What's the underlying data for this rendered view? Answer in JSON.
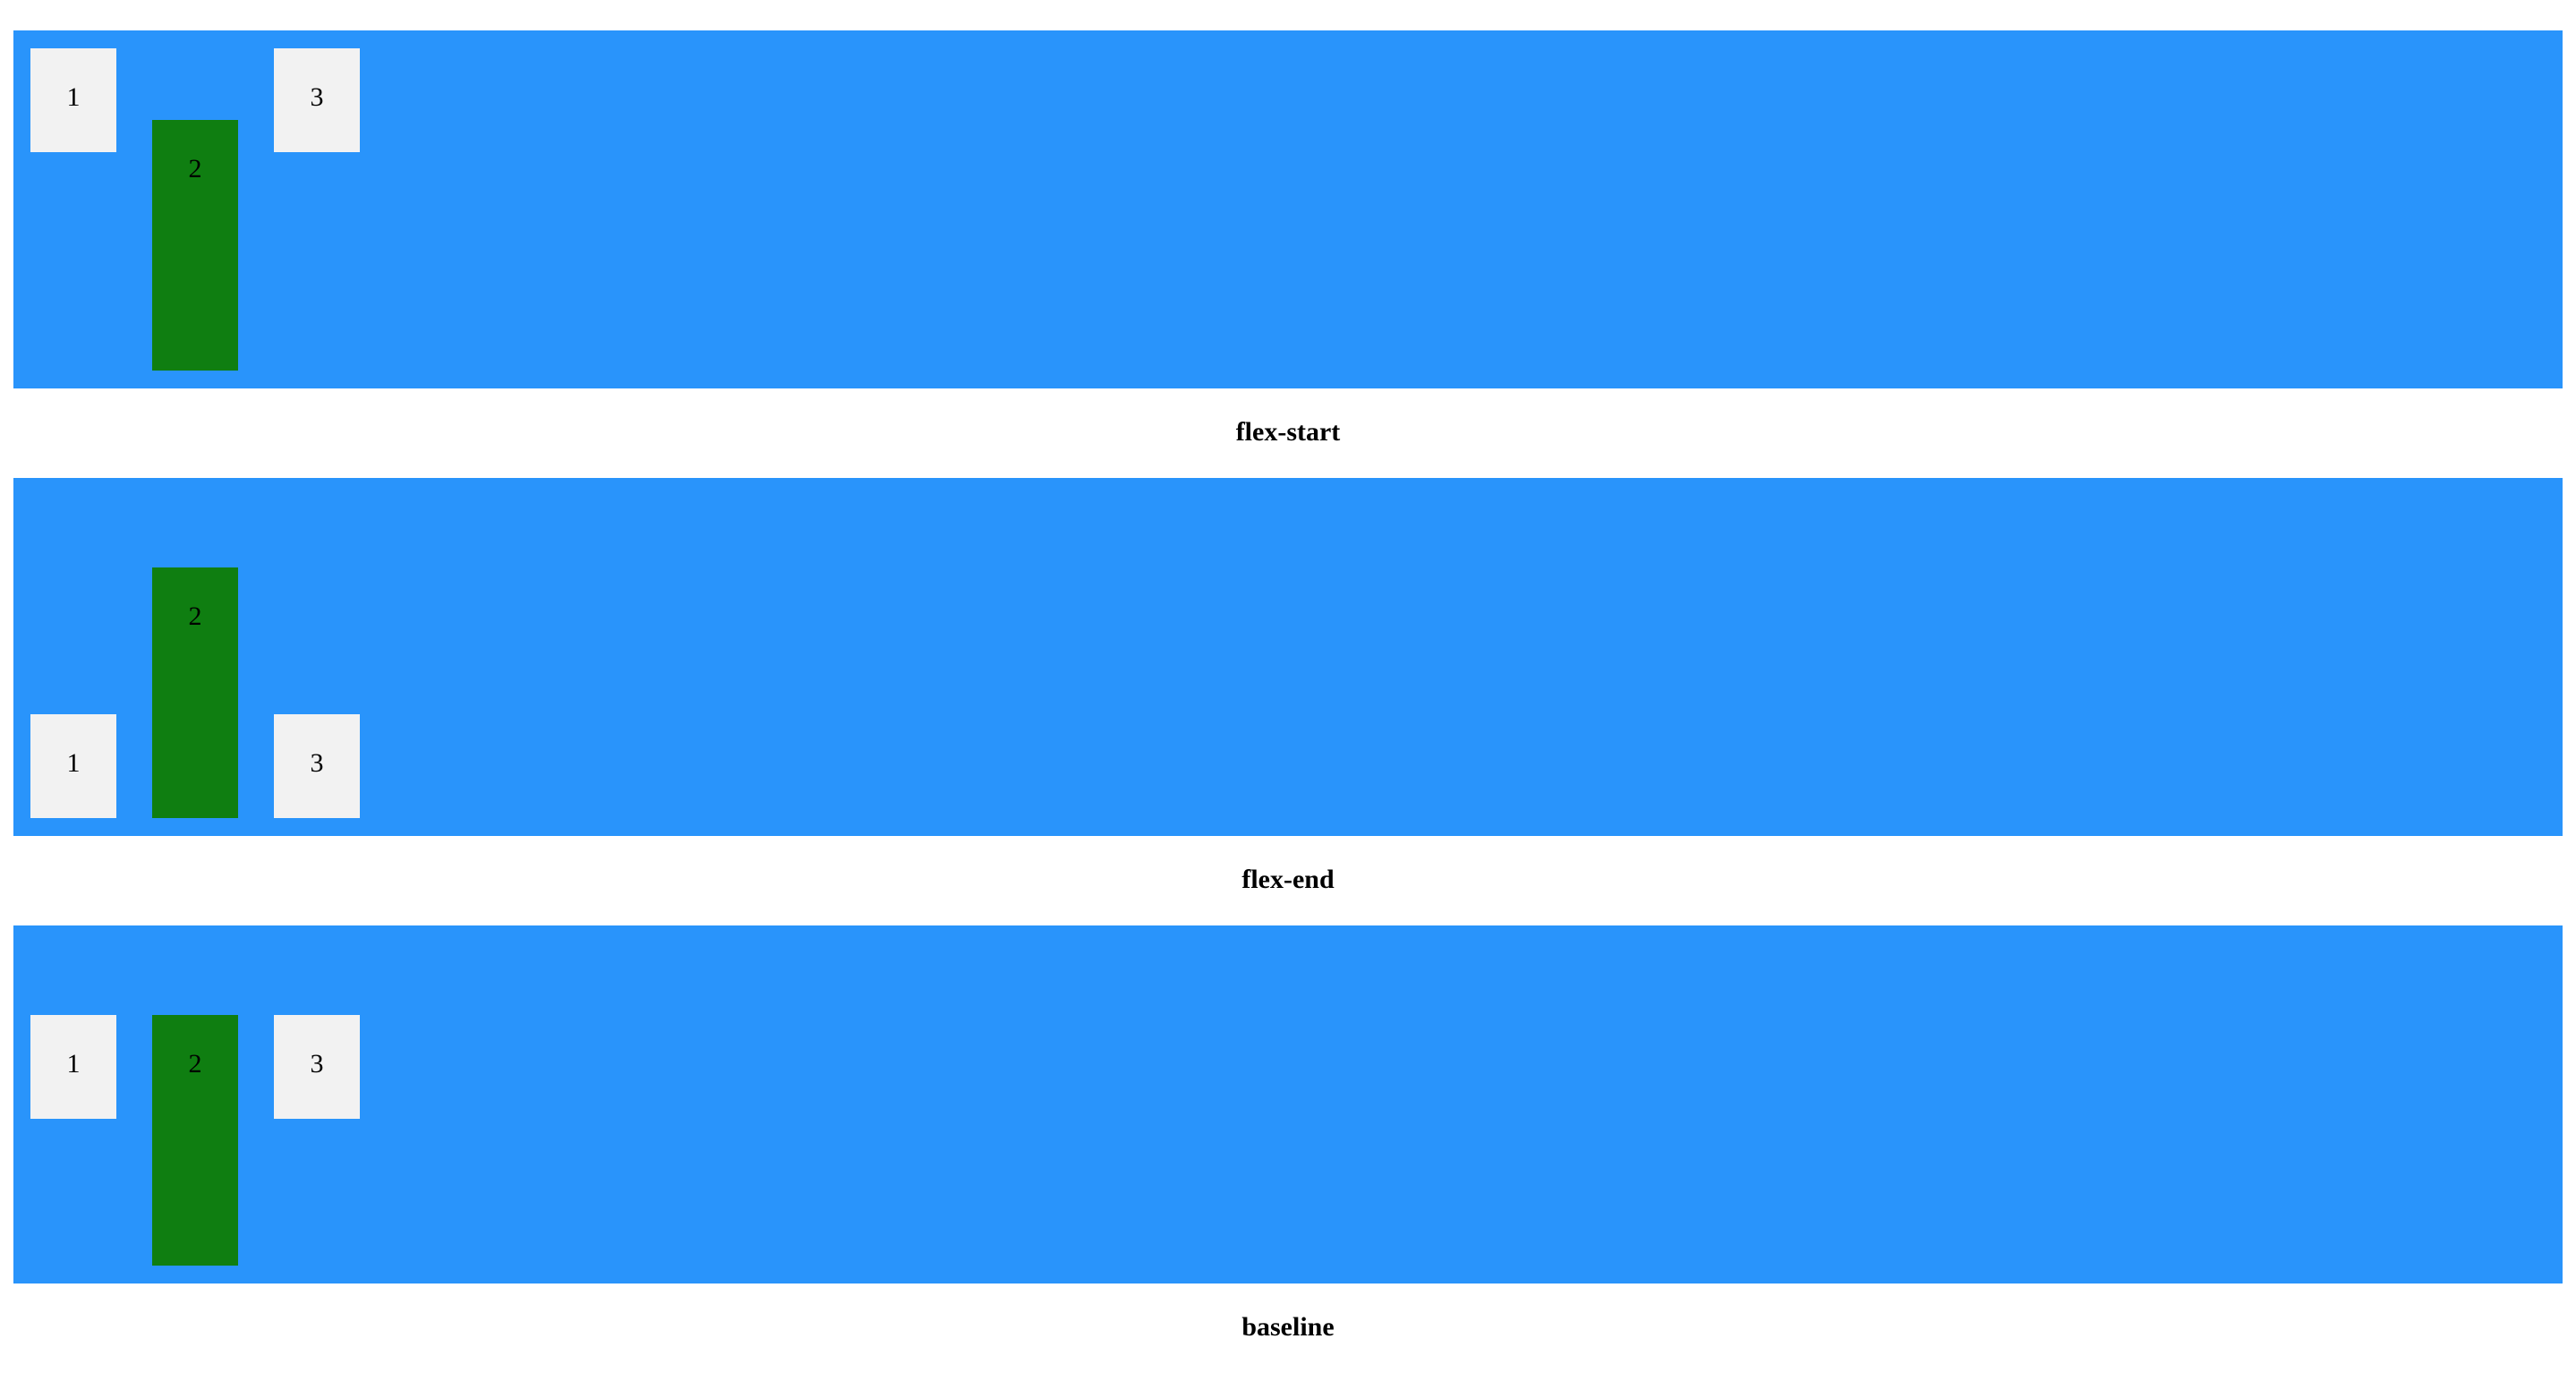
{
  "demos": [
    {
      "label": "flex-start",
      "items": [
        {
          "label": "1"
        },
        {
          "label": "2"
        },
        {
          "label": "3"
        }
      ]
    },
    {
      "label": "flex-end",
      "items": [
        {
          "label": "1"
        },
        {
          "label": "2"
        },
        {
          "label": "3"
        }
      ]
    },
    {
      "label": "baseline",
      "items": [
        {
          "label": "1"
        },
        {
          "label": "2"
        },
        {
          "label": "3"
        }
      ]
    }
  ],
  "colors": {
    "container": "#2994fb",
    "item": "#f2f2f2",
    "highlight_item": "#0f7e11"
  }
}
